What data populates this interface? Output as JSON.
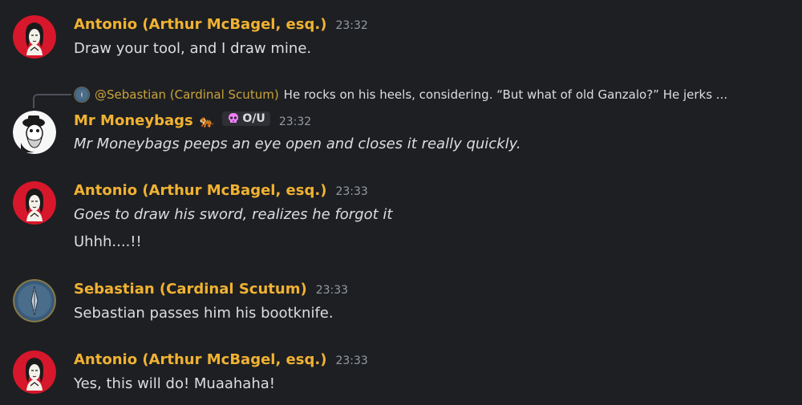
{
  "colors": {
    "username": "#f0b232",
    "background": "#1e1f22",
    "text": "#dbdee1",
    "timestamp": "#949ba4"
  },
  "messages": [
    {
      "username": "Antonio (Arthur McBagel, esq.)",
      "time": "23:32",
      "lines": [
        "Draw your tool, and I draw mine."
      ],
      "avatar": "antonio-avatar"
    },
    {
      "reply": {
        "name": "@Sebastian (Cardinal Scutum)",
        "text": "He rocks on his heels, considering. “But what of old Ganzalo?” He jerks ..."
      },
      "username": "Mr Moneybags",
      "badge_emoji": "🐅",
      "tag": "O/U",
      "time": "23:32",
      "lines": [
        "Mr Moneybags peeps an eye open and closes it really quickly."
      ],
      "avatar": "moneybags-avatar"
    },
    {
      "username": "Antonio (Arthur McBagel, esq.)",
      "time": "23:33",
      "lines": [
        "Goes to draw his sword, realizes he forgot it",
        "Uhhh....!!"
      ],
      "avatar": "antonio-avatar"
    },
    {
      "username": "Sebastian (Cardinal Scutum)",
      "time": "23:33",
      "lines": [
        "Sebastian passes him his bootknife."
      ],
      "avatar": "sebastian-avatar"
    },
    {
      "username": "Antonio (Arthur McBagel, esq.)",
      "time": "23:33",
      "lines": [
        "Yes, this will do! Muaahaha!"
      ],
      "avatar": "antonio-avatar"
    }
  ]
}
